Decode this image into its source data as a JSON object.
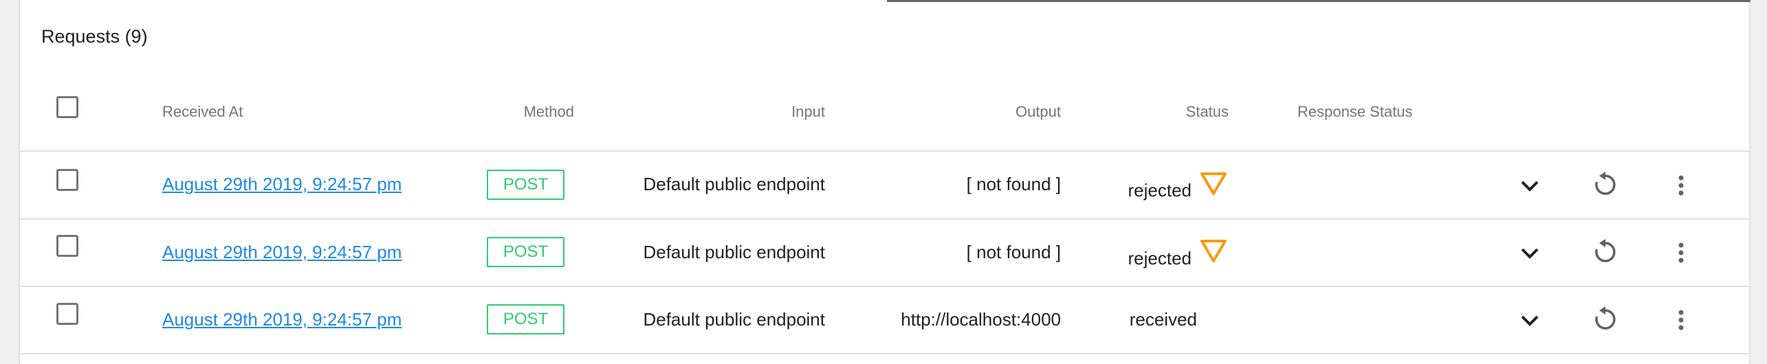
{
  "title": "Requests (9)",
  "colors": {
    "accent": "#1e88e5",
    "method": "#2ecc71",
    "warning": "#f39c12"
  },
  "columns": {
    "received_at": "Received At",
    "method": "Method",
    "input": "Input",
    "output": "Output",
    "status": "Status",
    "response_status": "Response Status"
  },
  "rows": [
    {
      "received_at": "August 29th 2019, 9:24:57 pm",
      "method": "POST",
      "input": "Default public endpoint",
      "output": "[ not found ]",
      "status": "rejected",
      "status_icon": "warning-triangle-icon"
    },
    {
      "received_at": "August 29th 2019, 9:24:57 pm",
      "method": "POST",
      "input": "Default public endpoint",
      "output": "[ not found ]",
      "status": "rejected",
      "status_icon": "warning-triangle-icon"
    },
    {
      "received_at": "August 29th 2019, 9:24:57 pm",
      "method": "POST",
      "input": "Default public endpoint",
      "output": "http://localhost:4000",
      "status": "received",
      "status_icon": ""
    }
  ],
  "row_icons": [
    "chevron-down-icon",
    "replay-icon",
    "more-vert-icon"
  ]
}
